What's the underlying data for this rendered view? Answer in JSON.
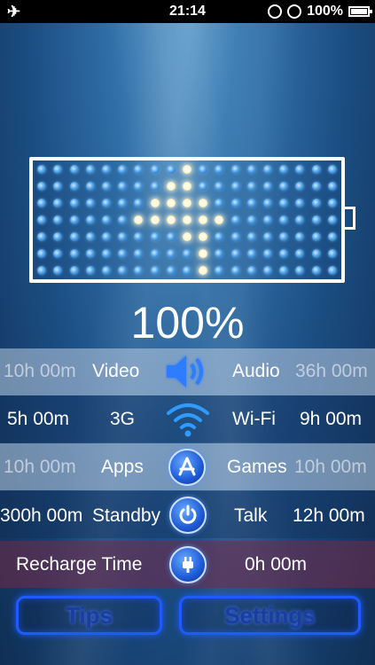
{
  "status_bar": {
    "airplane_icon": "airplane-icon",
    "time": "21:14",
    "battery_text": "100%"
  },
  "battery_display": {
    "level_percent": 100,
    "percent_label": "100%"
  },
  "rows": [
    {
      "left_value": "10h 00m",
      "left_label": "Video",
      "icon": "speaker-icon",
      "right_label": "Audio",
      "right_value": "36h 00m"
    },
    {
      "left_value": "5h 00m",
      "left_label": "3G",
      "icon": "wifi-icon",
      "right_label": "Wi-Fi",
      "right_value": "9h 00m"
    },
    {
      "left_value": "10h 00m",
      "left_label": "Apps",
      "icon": "app-store-icon",
      "right_label": "Games",
      "right_value": "10h 00m"
    },
    {
      "left_value": "300h 00m",
      "left_label": "Standby",
      "icon": "power-icon",
      "right_label": "Talk",
      "right_value": "12h 00m"
    }
  ],
  "recharge": {
    "label": "Recharge Time",
    "icon": "plug-icon",
    "value": "0h 00m"
  },
  "buttons": {
    "tips": "Tips",
    "settings": "Settings"
  },
  "colors": {
    "accent": "#1e5bff",
    "background": "#1b4d82"
  }
}
